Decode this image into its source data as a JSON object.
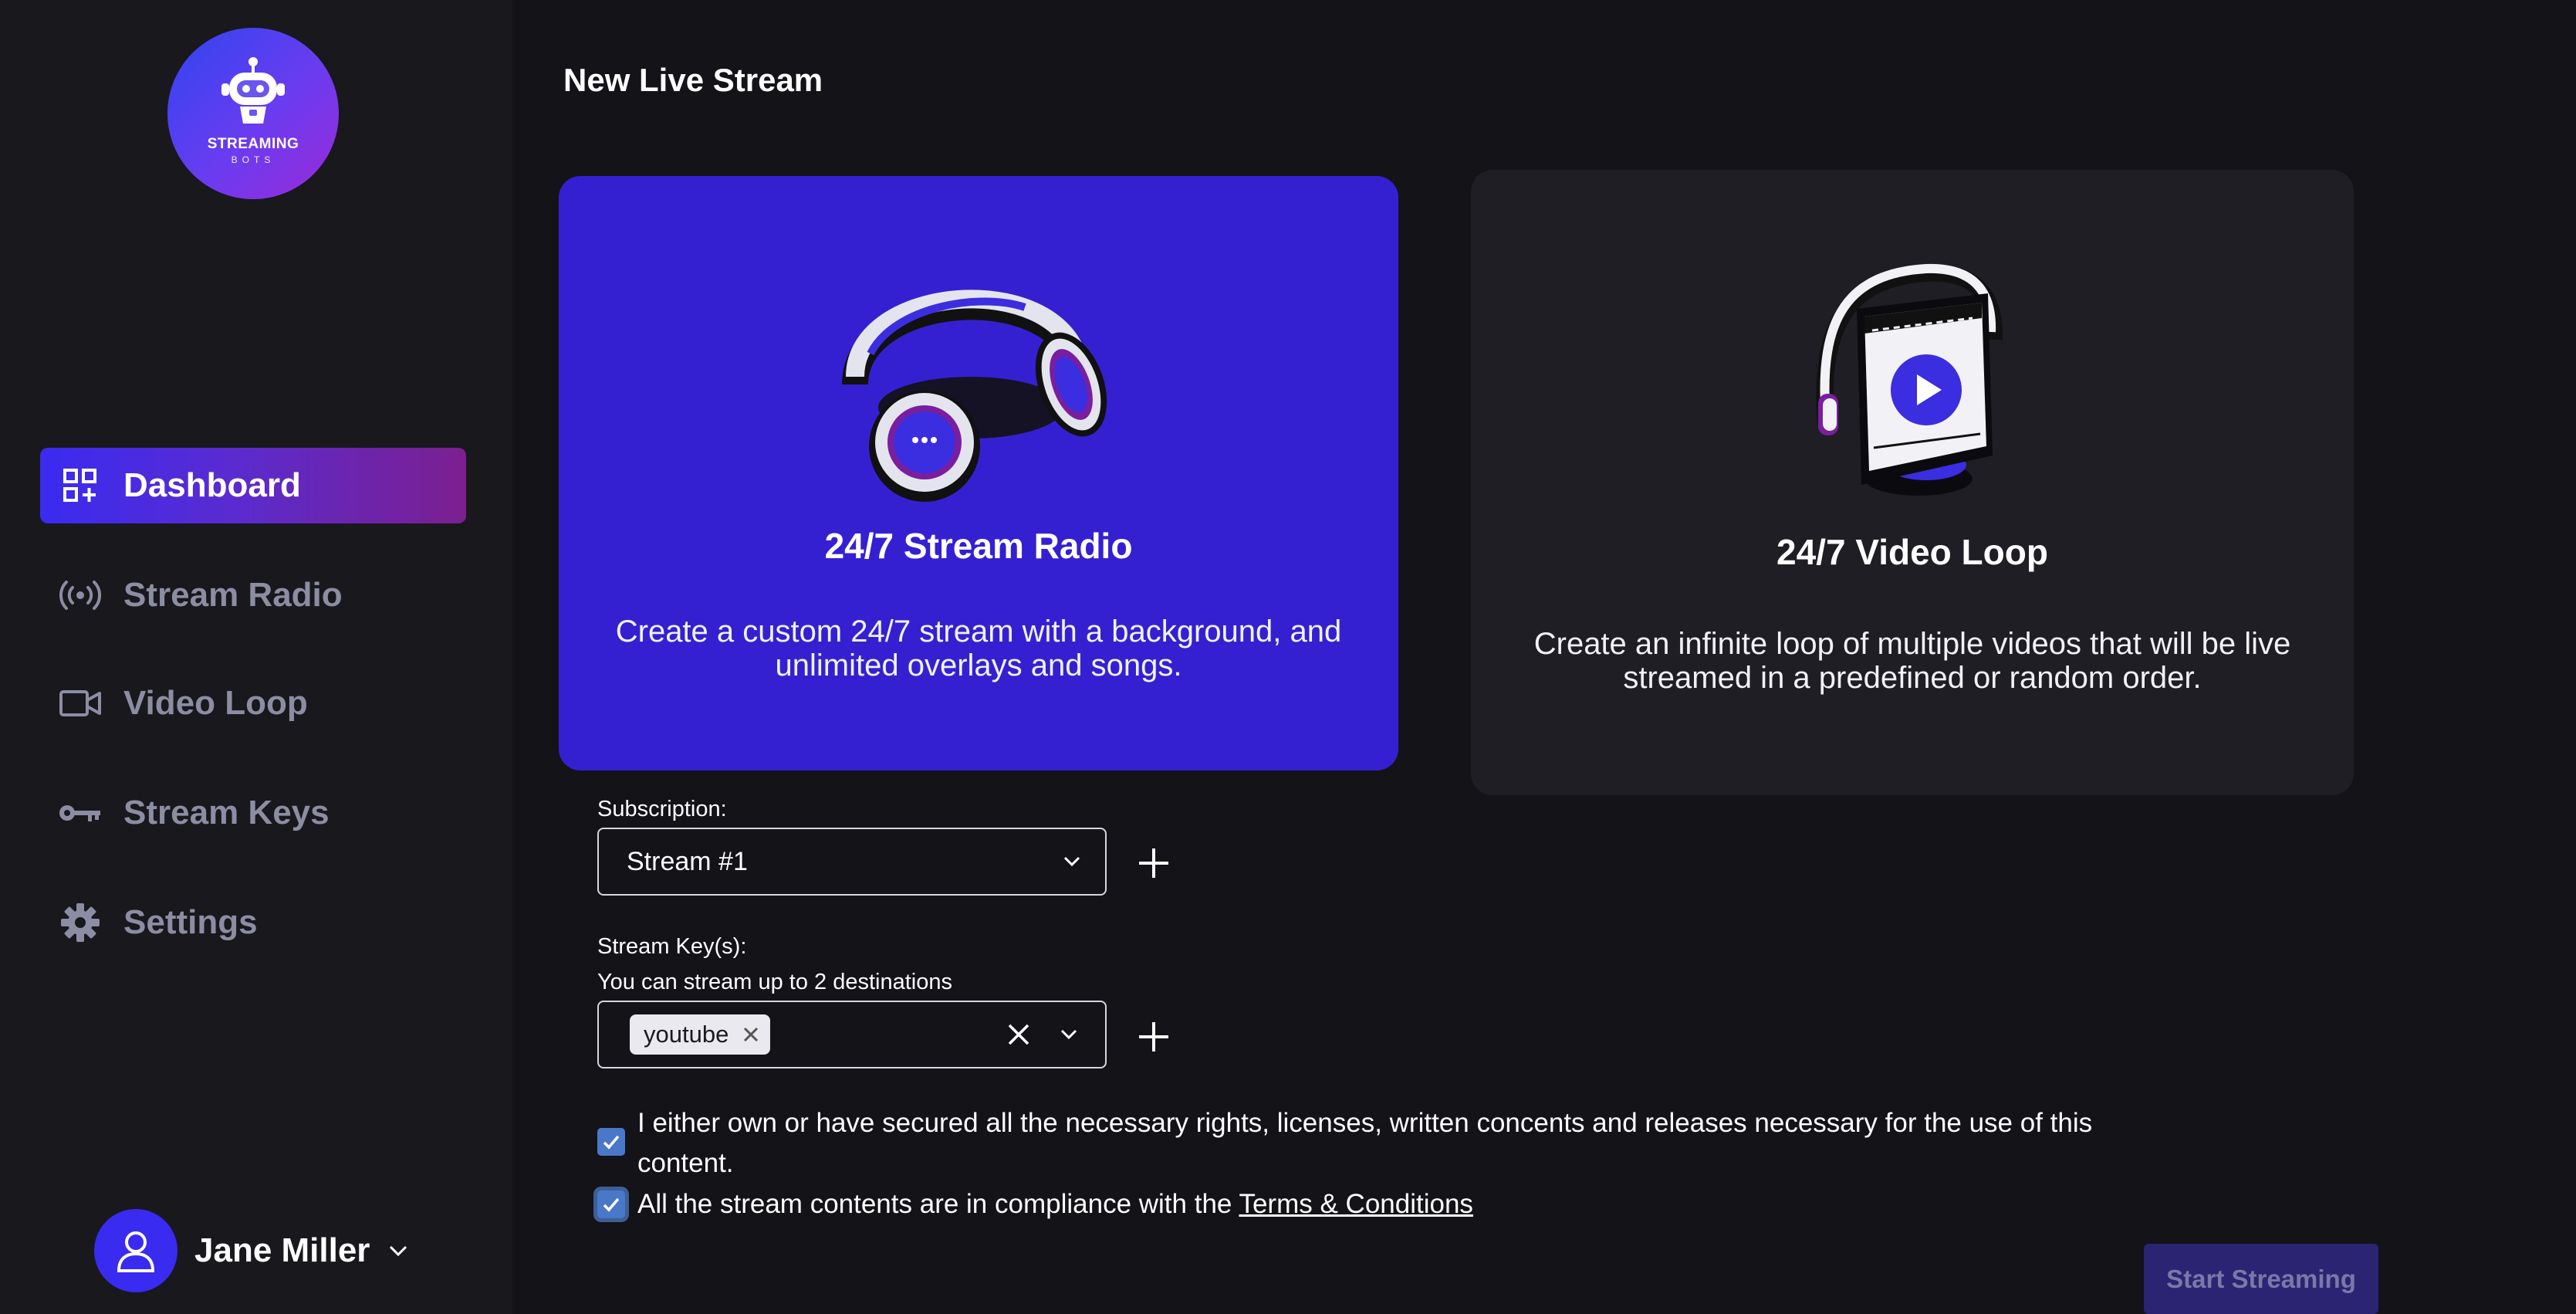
{
  "logo": {
    "line1": "STREAMING",
    "line2": "BOTS"
  },
  "sidebar": {
    "items": [
      {
        "label": "Dashboard",
        "icon": "dashboard-icon",
        "active": true
      },
      {
        "label": "Stream Radio",
        "icon": "broadcast-icon",
        "active": false
      },
      {
        "label": "Video Loop",
        "icon": "video-camera-icon",
        "active": false
      },
      {
        "label": "Stream Keys",
        "icon": "key-icon",
        "active": false
      },
      {
        "label": "Settings",
        "icon": "gear-icon",
        "active": false
      }
    ]
  },
  "user": {
    "name": "Jane Miller",
    "icon": "user-icon"
  },
  "main": {
    "title": "New Live Stream",
    "cards": [
      {
        "title": "24/7 Stream Radio",
        "description": "Create a custom 24/7 stream with a background, and unlimited overlays and songs.",
        "illustration": "headphones-icon",
        "selected": true
      },
      {
        "title": "24/7 Video Loop",
        "description": "Create an infinite loop of multiple videos that will be live streamed in a predefined or random order.",
        "illustration": "video-player-icon",
        "selected": false
      }
    ],
    "subscription": {
      "label": "Subscription:",
      "value": "Stream #1"
    },
    "stream_keys": {
      "label": "Stream Key(s):",
      "hint": "You can stream up to 2 destinations",
      "tags": [
        "youtube"
      ]
    },
    "checks": [
      {
        "text": "I either own or have secured all the necessary rights, licenses, written concents and releases necessary for the use of this content.",
        "checked": true
      },
      {
        "text": "All the stream contents are in compliance with the ",
        "link": "Terms & Conditions",
        "checked": true
      }
    ],
    "start_button": "Start Streaming"
  },
  "colors": {
    "accent": "#3520d1",
    "background": "#131318",
    "sidebar": "#18181d",
    "card_dark": "#1e1e24",
    "checkbox": "#4a78c8"
  }
}
